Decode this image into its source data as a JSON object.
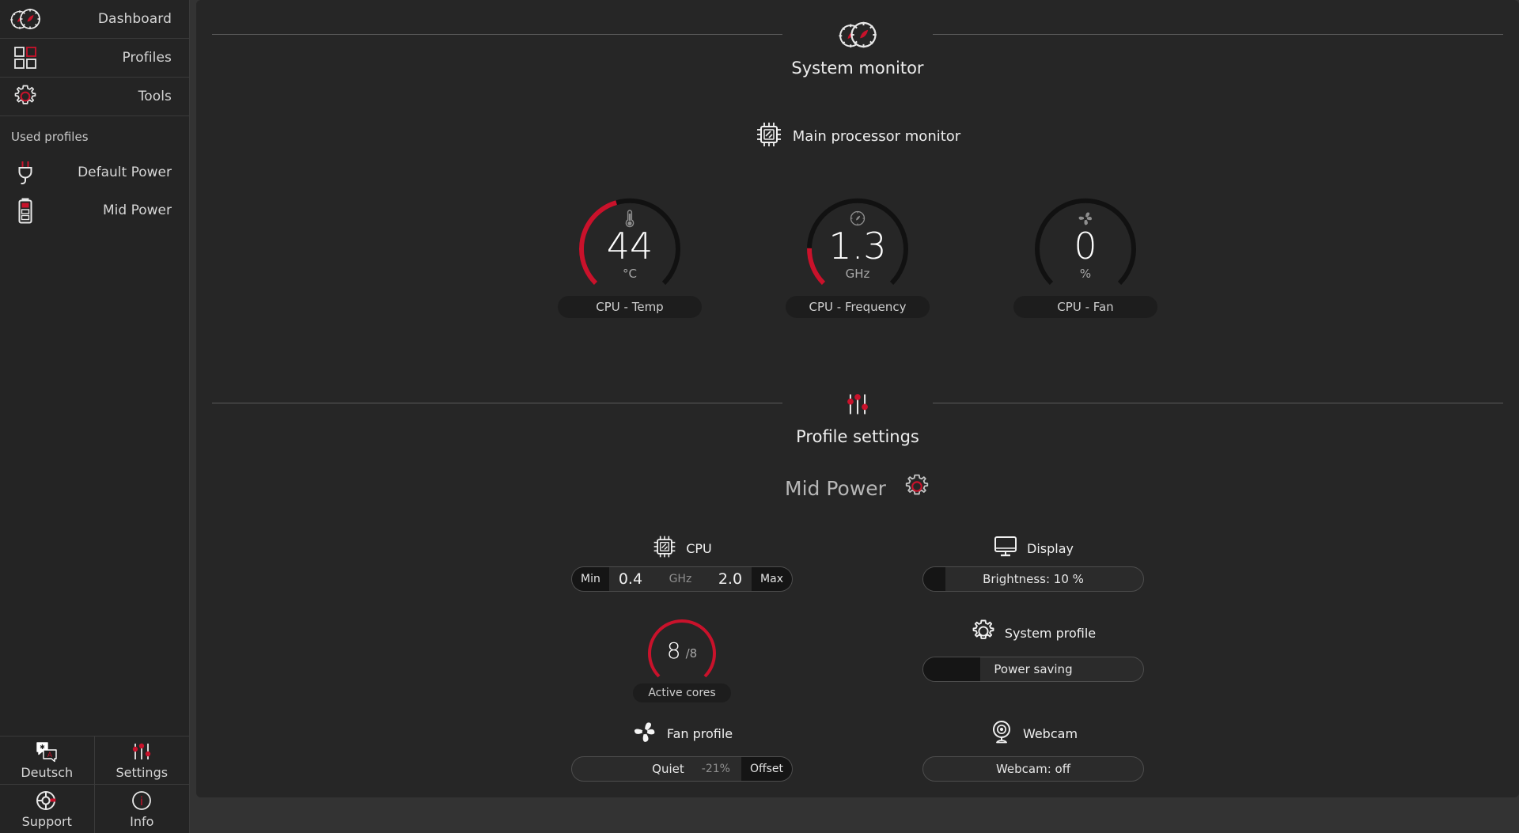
{
  "sidebar": {
    "nav": [
      {
        "label": "Dashboard",
        "icon": "dashboard-gauges-icon"
      },
      {
        "label": "Profiles",
        "icon": "grid-squares-icon"
      },
      {
        "label": "Tools",
        "icon": "gear-icon"
      }
    ],
    "used_profiles_caption": "Used profiles",
    "profiles": [
      {
        "label": "Default Power",
        "icon": "power-plug-icon"
      },
      {
        "label": "Mid Power",
        "icon": "battery-icon"
      }
    ],
    "bottom": [
      {
        "label": "Deutsch",
        "icon": "language-translate-icon"
      },
      {
        "label": "Settings",
        "icon": "sliders-icon"
      },
      {
        "label": "Support",
        "icon": "lifebuoy-icon"
      },
      {
        "label": "Info",
        "icon": "info-circle-icon"
      }
    ]
  },
  "system_monitor": {
    "title": "System monitor",
    "title_icon": "dashboard-gauges-icon",
    "subsection": {
      "label": "Main processor monitor",
      "icon": "cpu-chip-icon"
    },
    "gauges": [
      {
        "value": "44",
        "unit": "°C",
        "label": "CPU - Temp",
        "icon": "thermometer-icon",
        "percent": 44
      },
      {
        "value": "1.3",
        "unit": "GHz",
        "label": "CPU - Frequency",
        "icon": "speedometer-icon",
        "percent": 17
      },
      {
        "value": "0",
        "unit": "%",
        "label": "CPU - Fan",
        "icon": "fan-icon",
        "percent": 0
      }
    ]
  },
  "profile_settings": {
    "title": "Profile settings",
    "title_icon": "sliders-icon",
    "profile_name": "Mid Power",
    "profile_icon": "gear-icon",
    "cpu": {
      "label": "CPU",
      "icon": "cpu-chip-icon",
      "min_label": "Min",
      "min_value": "0.4",
      "unit": "GHz",
      "max_value": "2.0",
      "max_label": "Max"
    },
    "display": {
      "label": "Display",
      "icon": "monitor-icon",
      "value_text": "Brightness: 10 %",
      "fill_percent": 10
    },
    "active_cores": {
      "value": "8",
      "total": "/8",
      "label": "Active cores",
      "percent": 100
    },
    "system_profile": {
      "label": "System profile",
      "icon": "gear-icon",
      "value_text": "Power saving",
      "fill_percent": 26
    },
    "fan_profile": {
      "label": "Fan profile",
      "icon": "fan-icon",
      "value_text": "Quiet",
      "offset_value": "-21%",
      "offset_label": "Offset"
    },
    "webcam": {
      "label": "Webcam",
      "icon": "webcam-icon",
      "value_text": "Webcam: off",
      "fill_percent": 0
    }
  },
  "colors": {
    "accent_red": "#c9122b",
    "panel_bg": "#262626",
    "sidebar_bg": "#242424",
    "window_bg": "#333333"
  }
}
